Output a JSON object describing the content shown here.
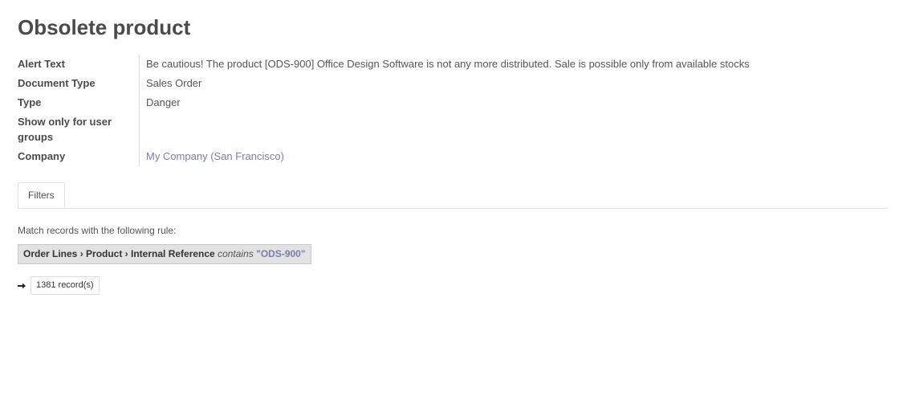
{
  "header": {
    "title": "Obsolete product"
  },
  "fields": [
    {
      "label": "Alert Text",
      "value": "Be cautious! The product [ODS-900] Office Design Software is not any more distributed. Sale is possible only from available stocks"
    },
    {
      "label": "Document Type",
      "value": "Sales Order"
    },
    {
      "label": "Type",
      "value": "Danger"
    },
    {
      "label": "Show only for user groups",
      "value": ""
    },
    {
      "label": "Company",
      "value": "My Company (San Francisco)"
    }
  ],
  "tabs": [
    {
      "label": "Filters"
    }
  ],
  "filter": {
    "intro": "Match records with the following rule:",
    "path": "Order Lines › Product › Internal Reference",
    "operator": "contains",
    "value": "\"ODS-900\"",
    "records_label": "1381 record(s)"
  },
  "colors": {
    "link": "#7c7bad"
  }
}
